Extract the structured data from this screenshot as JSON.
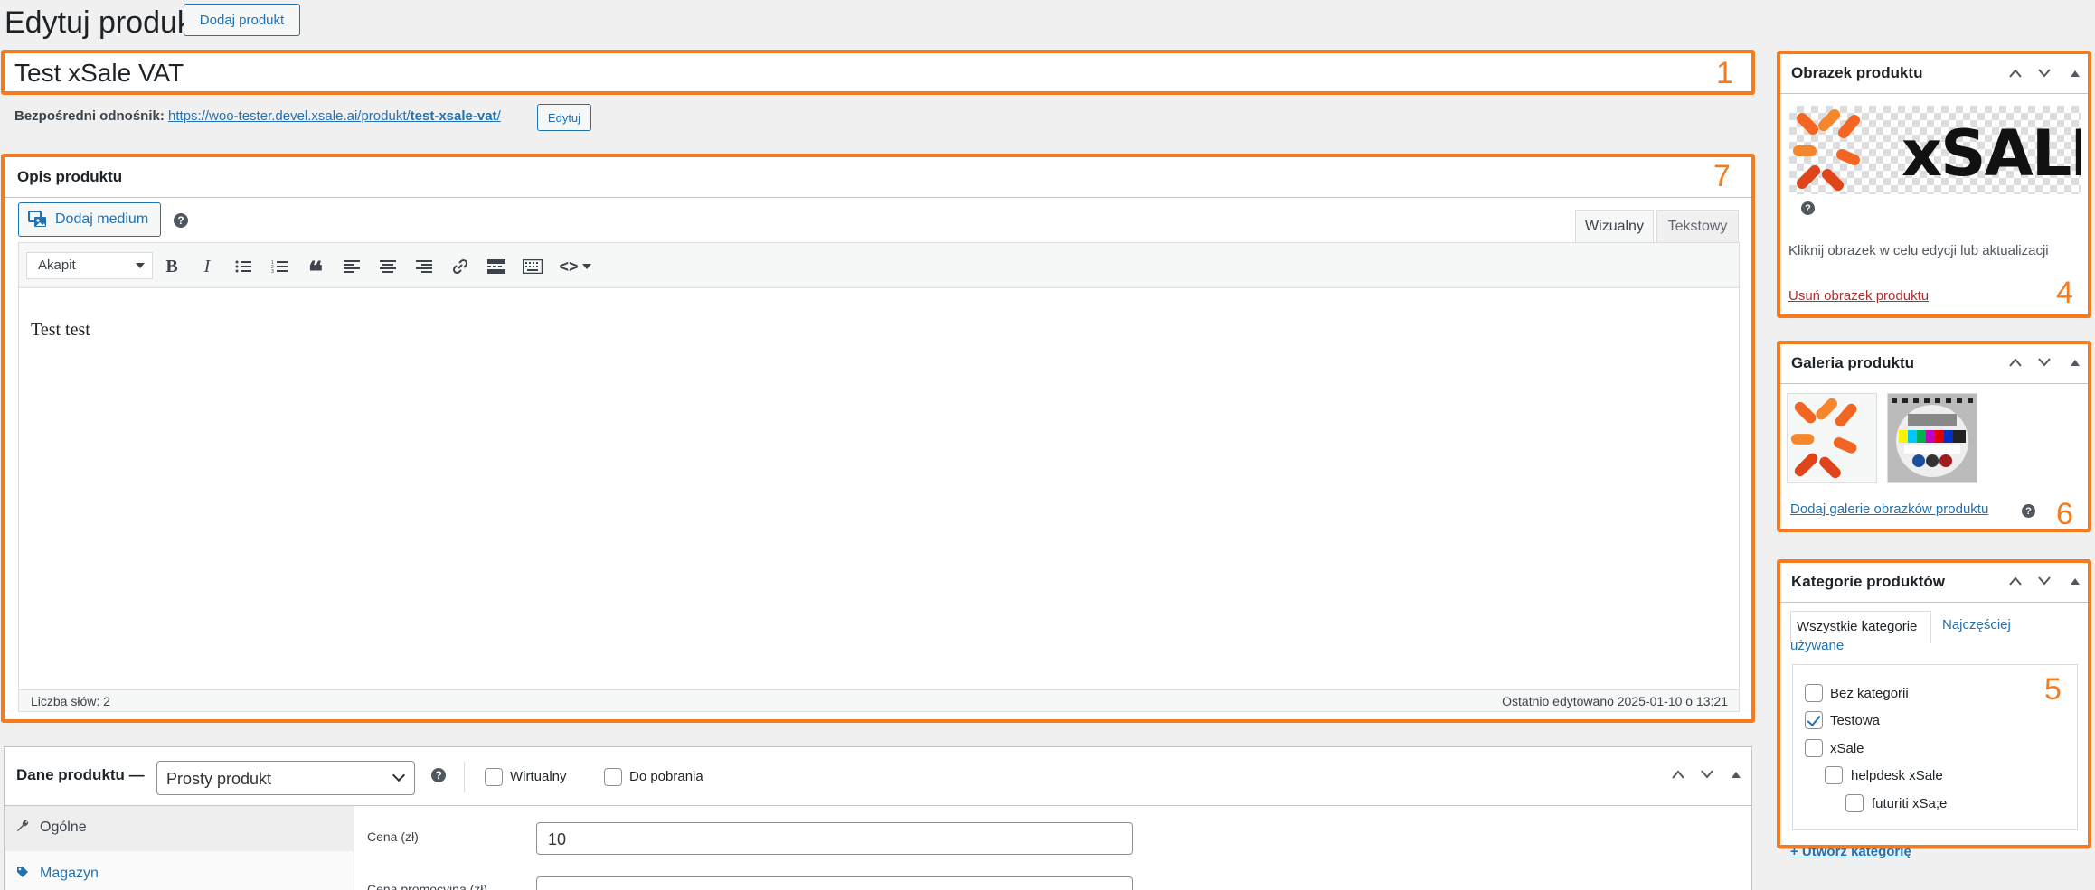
{
  "header": {
    "title": "Edytuj produkt",
    "add_button": "Dodaj produkt"
  },
  "product": {
    "title": "Test xSale VAT",
    "permalink_label": "Bezpośredni odnośnik:",
    "permalink_base": "https://woo-tester.devel.xsale.ai/produkt/",
    "permalink_slug": "test-xsale-vat",
    "permalink_end": "/",
    "permalink_edit": "Edytuj"
  },
  "description": {
    "title": "Opis produktu",
    "add_media": "Dodaj medium",
    "tab_visual": "Wizualny",
    "tab_text": "Tekstowy",
    "format_select": "Akapit",
    "content": "Test test",
    "word_count": "Liczba słów: 2",
    "last_edited": "Ostatnio edytowano 2025-01-10 o 13:21"
  },
  "product_data": {
    "title": "Dane produktu —",
    "type": "Prosty produkt",
    "virtual_label": "Wirtualny",
    "downloadable_label": "Do pobrania",
    "tabs": [
      {
        "label": "Ogólne",
        "icon": "wrench-icon"
      },
      {
        "label": "Magazyn",
        "icon": "tag-icon"
      }
    ],
    "price_label": "Cena (zł)",
    "price_value": "10",
    "sale_price_label": "Cena promocyjna (zł)"
  },
  "product_image": {
    "title": "Obrazek produktu",
    "hint": "Kliknij obrazek w celu edycji lub aktualizacji",
    "remove": "Usuń obrazek produktu",
    "logo_text": "xSALE"
  },
  "gallery": {
    "title": "Galeria produktu",
    "add": "Dodaj galerie obrazków produktu"
  },
  "categories": {
    "title": "Kategorie produktów",
    "tab_all": "Wszystkie kategorie",
    "tab_popular_1": "Najczęściej",
    "tab_popular_2": "używane",
    "items": [
      {
        "label": "Bez kategorii",
        "checked": false,
        "level": 0
      },
      {
        "label": "Testowa",
        "checked": true,
        "level": 0
      },
      {
        "label": "xSale",
        "checked": false,
        "level": 0
      },
      {
        "label": "helpdesk xSale",
        "checked": false,
        "level": 1
      },
      {
        "label": "futuriti xSa;e",
        "checked": false,
        "level": 2
      }
    ],
    "create": "+ Utwórz kategorię"
  },
  "annotations": [
    "1",
    "7",
    "4",
    "6",
    "5"
  ],
  "colors": {
    "highlight": "#f47b20",
    "link": "#2271b1",
    "brand_orange": "#f26522"
  }
}
